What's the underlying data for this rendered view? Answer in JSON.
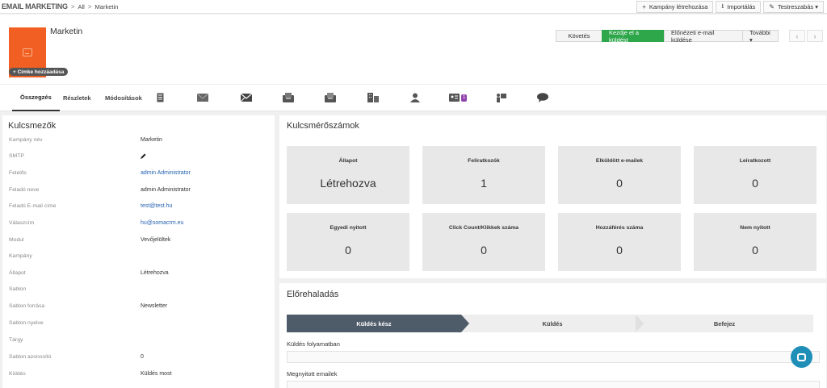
{
  "breadcrumb": {
    "module": "EMAIL MARKETING",
    "sep": ">",
    "all": "All",
    "current": "Marketin"
  },
  "top_actions": [
    {
      "icon": "+",
      "label": "Kampány létrehozása"
    },
    {
      "icon": "⭳",
      "label": "Importálás"
    },
    {
      "icon": "✎",
      "label": "Testreszabás ▾"
    }
  ],
  "record": {
    "title": "Marketin",
    "tag_label": "+ Címke hozzáadása"
  },
  "header_actions": {
    "follow": "Követés",
    "start": "Kezdje el a küldést",
    "preview": "Előnézeti e-mail küldése",
    "more": "További ▾"
  },
  "nav": {
    "prev": "‹",
    "next": "›"
  },
  "tabs": {
    "summary": "Összegzés",
    "details": "Részletek",
    "updates": "Módosítások",
    "badge_count": "1"
  },
  "key_fields": {
    "title": "Kulcsmezők",
    "rows": [
      {
        "label": "Kampány név",
        "value": "Marketin",
        "type": "text"
      },
      {
        "label": "SMTP",
        "value": "",
        "type": "edit"
      },
      {
        "label": "Felelős",
        "value": "admin Administrator",
        "type": "link"
      },
      {
        "label": "Feladó neve",
        "value": "admin Administrator",
        "type": "text"
      },
      {
        "label": "Feladó E-mail címe",
        "value": "test@test.hu",
        "type": "link"
      },
      {
        "label": "Válaszcím",
        "value": "hu@somacrm.eu",
        "type": "link"
      },
      {
        "label": "Modul",
        "value": "Vevőjelöltek",
        "type": "text"
      },
      {
        "label": "Kampány",
        "value": "",
        "type": "text"
      },
      {
        "label": "Állapot",
        "value": "Létrehozva",
        "type": "text"
      },
      {
        "label": "Sablon",
        "value": "",
        "type": "text"
      },
      {
        "label": "Sablon forrása",
        "value": "Newsletter",
        "type": "text"
      },
      {
        "label": "Sablon nyelve",
        "value": "",
        "type": "text"
      },
      {
        "label": "Tárgy",
        "value": "",
        "type": "text"
      },
      {
        "label": "Sablon azonosító",
        "value": "0",
        "type": "text"
      },
      {
        "label": "Küldés",
        "value": "Küldés most",
        "type": "text"
      }
    ]
  },
  "metrics": {
    "title": "Kulcsmérőszámok",
    "items": [
      {
        "label": "Állapot",
        "value": "Létrehozva"
      },
      {
        "label": "Feliratkozók",
        "value": "1"
      },
      {
        "label": "Elküldött e-mailek",
        "value": "0"
      },
      {
        "label": "Leiratkozott",
        "value": "0"
      },
      {
        "label": "Egyedi nyitott",
        "value": "0"
      },
      {
        "label": "Click Count/Klikkek száma",
        "value": "0"
      },
      {
        "label": "Hozzáférés száma",
        "value": "0"
      },
      {
        "label": "Nem nyitott",
        "value": "0"
      }
    ]
  },
  "progress": {
    "title": "Előrehaladás",
    "steps": [
      "Küldés kész",
      "Küldés",
      "Befejez"
    ],
    "active_step_color": "#4e5b69",
    "bars": [
      {
        "label": "Küldés folyamatban"
      },
      {
        "label": "Megnyitott emailek"
      }
    ]
  },
  "colors": {
    "accent_green": "#2ea64a",
    "brand_orange": "#f15f22",
    "link_blue": "#2563b0",
    "badge_purple": "#8e44ad",
    "chat_blue": "#1f8fb8"
  }
}
